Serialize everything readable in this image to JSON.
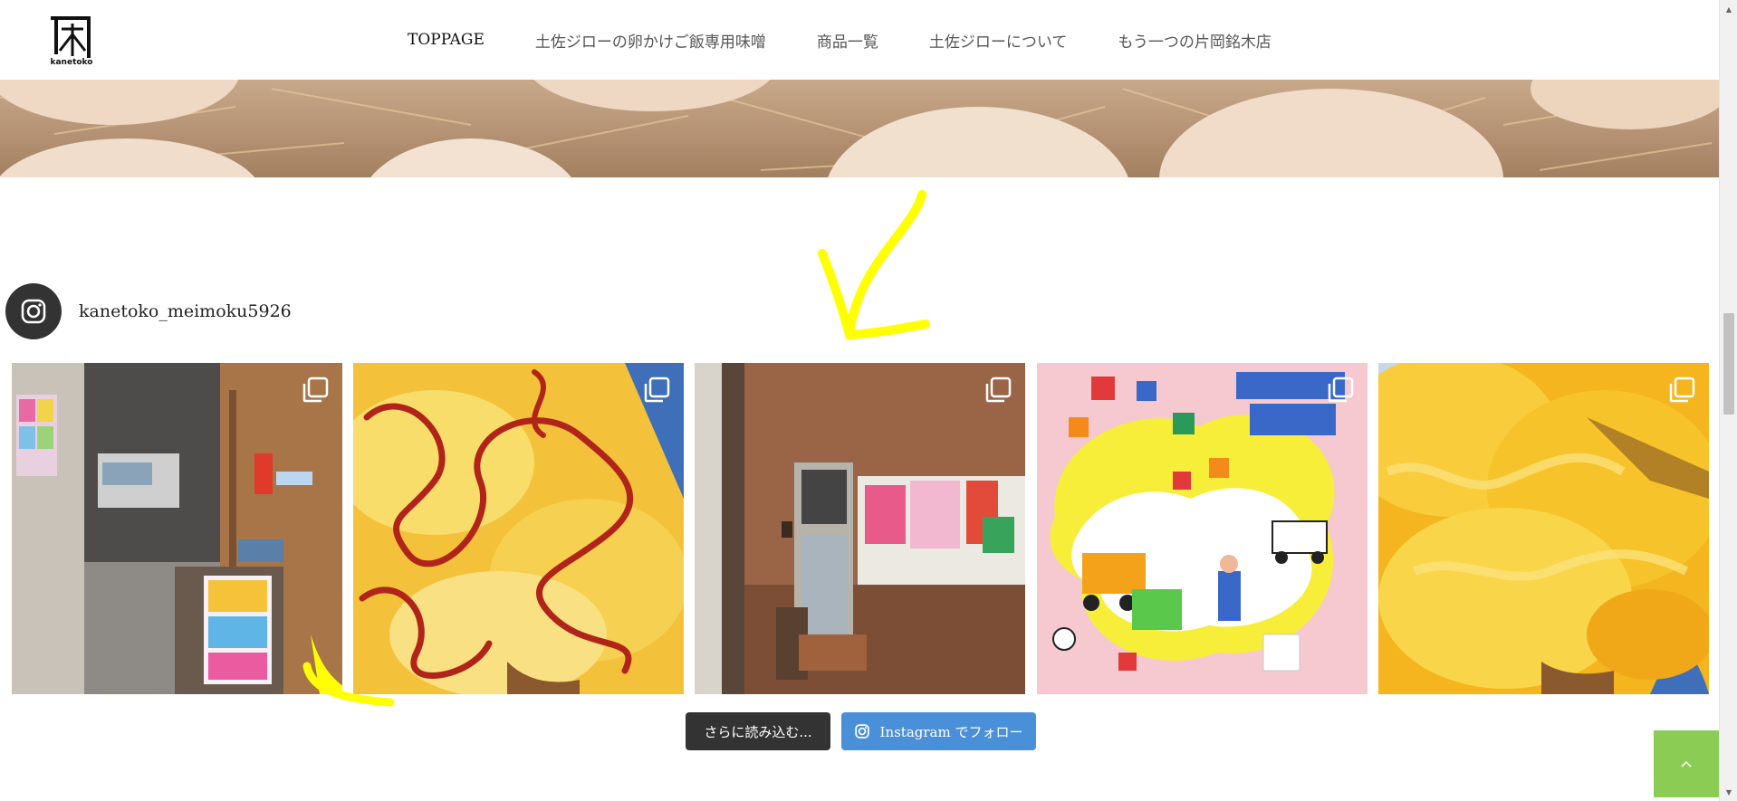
{
  "brand": {
    "logo_alt": "kanetoko",
    "logo_text": "kanetoko"
  },
  "nav": {
    "items": [
      "TOPPAGE",
      "土佐ジローの卵かけご飯専用味噌",
      "商品一覧",
      "土佐ジローについて",
      "もう一つの片岡銘木店"
    ]
  },
  "instagram": {
    "username": "kanetoko_meimoku5926",
    "posts": [
      {
        "icon": "multi-photo-icon"
      },
      {
        "icon": "multi-photo-icon"
      },
      {
        "icon": "multi-photo-icon"
      },
      {
        "icon": "multi-photo-icon"
      },
      {
        "icon": "multi-photo-icon"
      }
    ],
    "load_more_label": "さらに読み込む...",
    "follow_label": "Instagram でフォロー"
  },
  "colors": {
    "follow_button": "#4a90d9",
    "load_more_button": "#333333",
    "back_to_top": "#8bcc55",
    "annotation_arrow": "#ffff00"
  }
}
